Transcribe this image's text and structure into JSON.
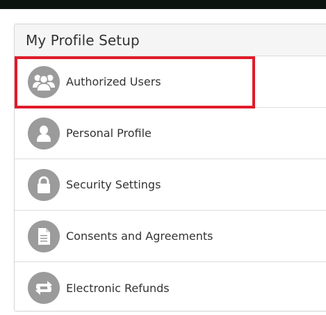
{
  "panel": {
    "title": "My Profile Setup",
    "items": [
      {
        "label": "Authorized Users",
        "icon": "users-icon"
      },
      {
        "label": "Personal Profile",
        "icon": "user-icon"
      },
      {
        "label": "Security Settings",
        "icon": "lock-icon"
      },
      {
        "label": "Consents and Agreements",
        "icon": "document-icon"
      },
      {
        "label": "Electronic Refunds",
        "icon": "refund-arrows-icon"
      }
    ]
  },
  "colors": {
    "icon_background": "#9b9b9b",
    "highlight": "#e11b2a",
    "top_bar": "#0c1410"
  }
}
